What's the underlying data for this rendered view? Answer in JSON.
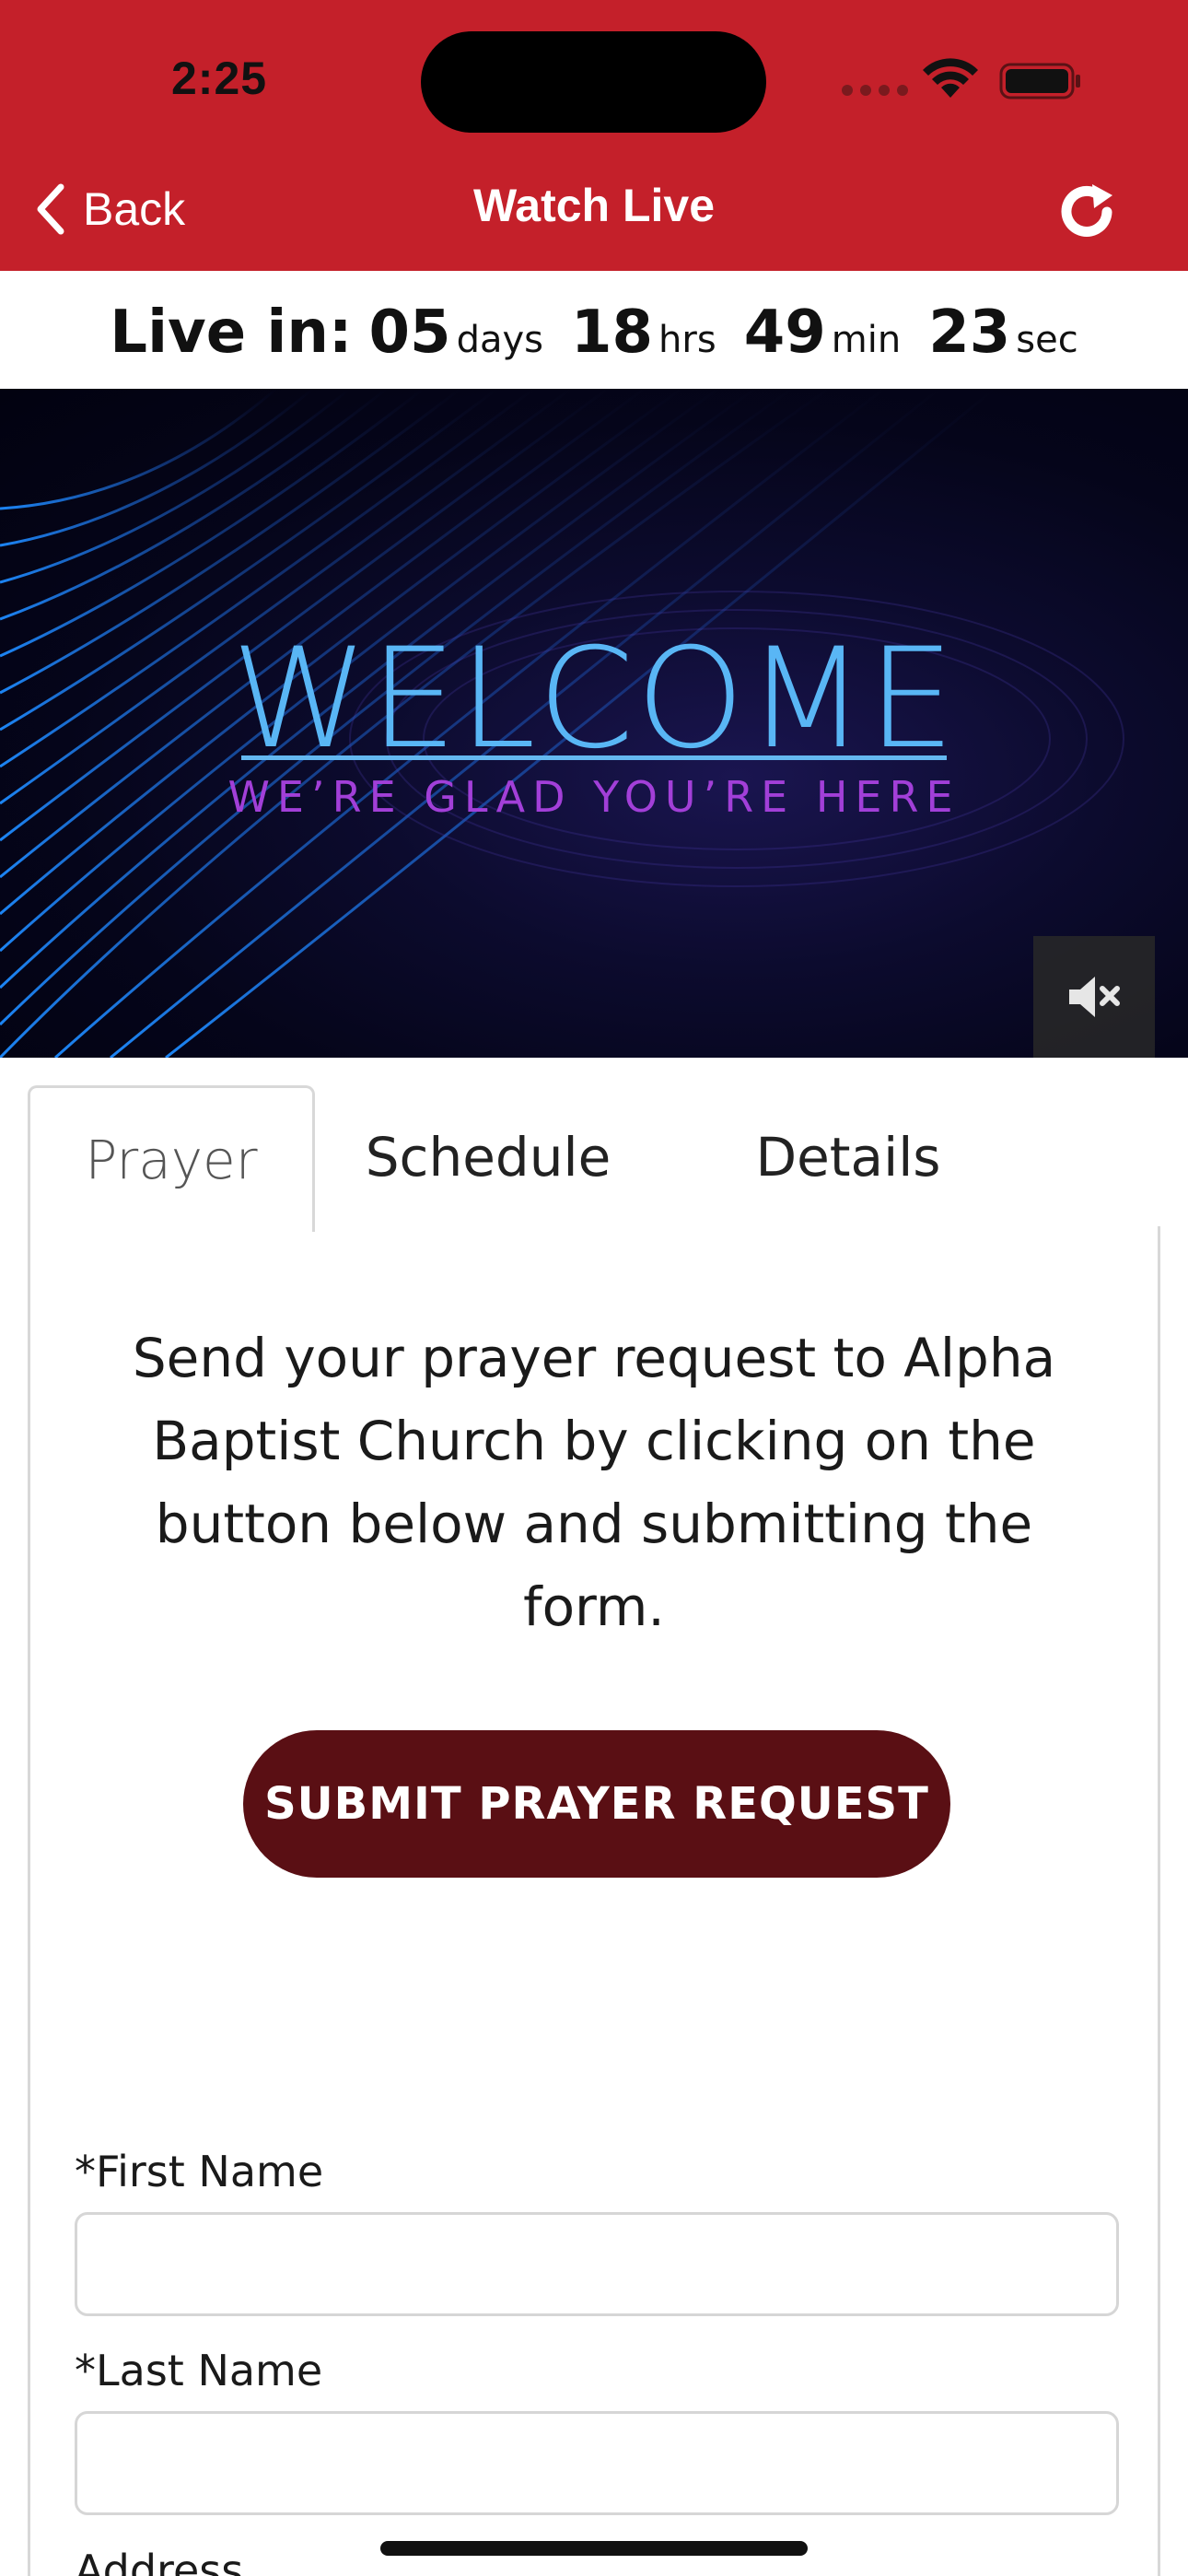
{
  "status_bar": {
    "time": "2:25"
  },
  "nav": {
    "back_label": "Back",
    "title": "Watch Live"
  },
  "countdown": {
    "label": "Live in:",
    "days": "05",
    "days_unit": "days",
    "hours": "18",
    "hours_unit": "hrs",
    "minutes": "49",
    "minutes_unit": "min",
    "seconds": "23",
    "seconds_unit": "sec"
  },
  "video": {
    "title": "WELCOME",
    "subtitle": "WE’RE GLAD YOU’RE HERE",
    "muted": true
  },
  "tabs": [
    {
      "label": "Prayer",
      "active": true
    },
    {
      "label": "Schedule",
      "active": false
    },
    {
      "label": "Details",
      "active": false
    }
  ],
  "prayer": {
    "intro": "Send your prayer request to Alpha Baptist Church by clicking on the button below and submitting the form.",
    "submit_label": "SUBMIT PRAYER REQUEST",
    "fields": [
      {
        "label": "*First Name",
        "value": ""
      },
      {
        "label": "*Last Name",
        "value": ""
      },
      {
        "label": "Address"
      }
    ]
  },
  "colors": {
    "header": "#c4202a",
    "submit_button": "#5a0f14",
    "welcome_title": "#59b6f5",
    "welcome_subtitle": "#a23fd8"
  }
}
